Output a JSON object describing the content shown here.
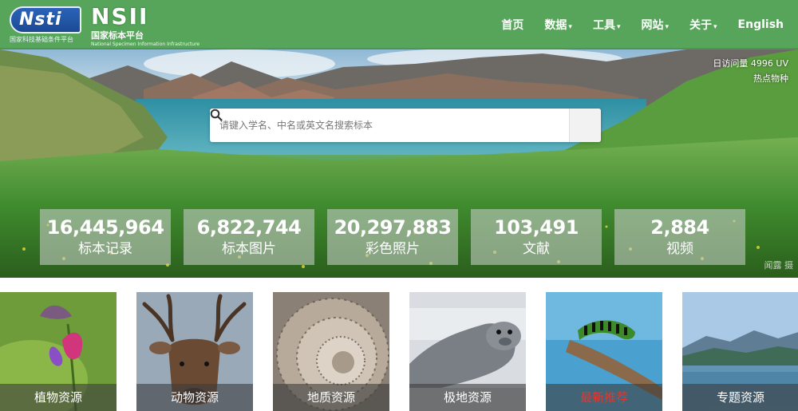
{
  "header": {
    "logo1": {
      "mark": "Nsti",
      "sub": "国家科技基础条件平台"
    },
    "logo2": {
      "mark": "NSII",
      "sub": "国家标本平台",
      "sub2": "National Specimen Information Infrastructure"
    },
    "nav": [
      {
        "label": "首页",
        "dropdown": false
      },
      {
        "label": "数据",
        "dropdown": true
      },
      {
        "label": "工具",
        "dropdown": true
      },
      {
        "label": "网站",
        "dropdown": true
      },
      {
        "label": "关于",
        "dropdown": true
      },
      {
        "label": "English",
        "dropdown": false
      }
    ],
    "colors": {
      "bar": "#57a55a"
    }
  },
  "hero": {
    "visits": "日访问量 4996 UV",
    "hot_species": "热点物种",
    "search": {
      "placeholder": "请键入学名、中名或英文名搜索标本",
      "value": ""
    },
    "counters": [
      {
        "value": "16,445,964",
        "label": "标本记录"
      },
      {
        "value": "6,822,744",
        "label": "标本图片"
      },
      {
        "value": "20,297,883",
        "label": "彩色照片"
      },
      {
        "value": "103,491",
        "label": "文献"
      },
      {
        "value": "2,884",
        "label": "视频"
      }
    ],
    "credit": "闻露 摄"
  },
  "categories": [
    {
      "label": "植物资源",
      "highlight": false
    },
    {
      "label": "动物资源",
      "highlight": false
    },
    {
      "label": "地质资源",
      "highlight": false
    },
    {
      "label": "极地资源",
      "highlight": false
    },
    {
      "label": "最新推荐",
      "highlight": true,
      "color": "#e8352b"
    },
    {
      "label": "专题资源",
      "highlight": false
    }
  ]
}
